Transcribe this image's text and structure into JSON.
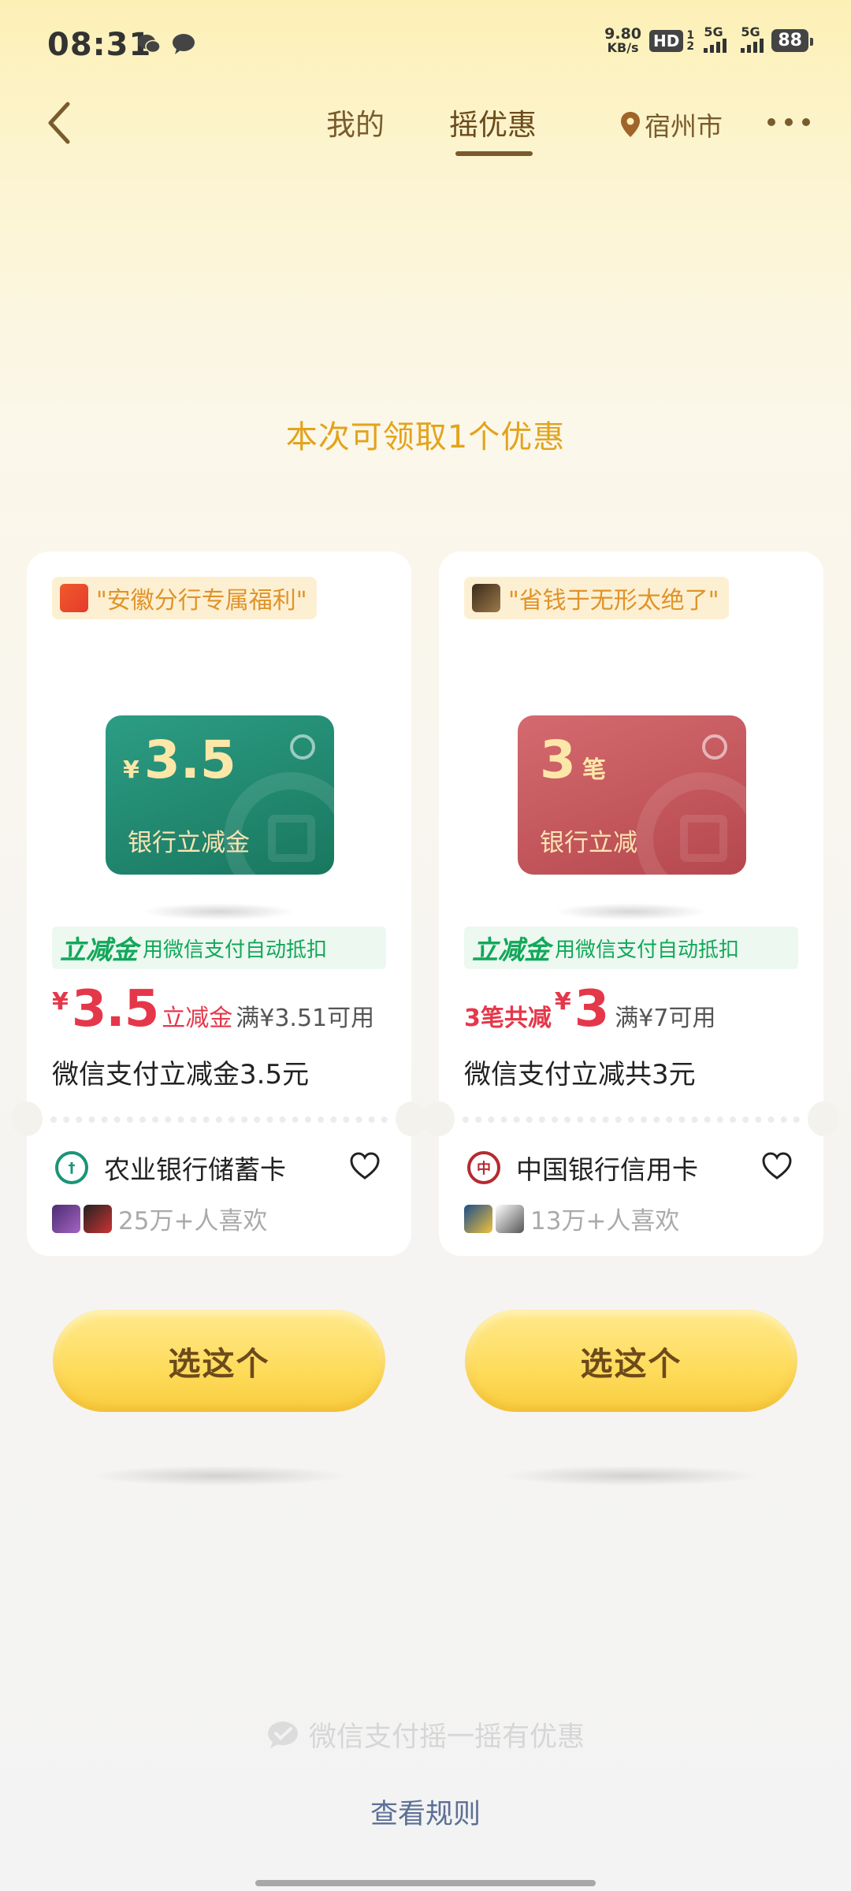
{
  "status_bar": {
    "time": "08:31",
    "net_speed_value": "9.80",
    "net_speed_unit": "KB/s",
    "hd_badge": "HD",
    "hd_sub": "1 2",
    "signal1": "5G",
    "signal2": "5G",
    "battery": "88"
  },
  "header": {
    "tabs": [
      {
        "label": "我的",
        "active": false
      },
      {
        "label": "摇优惠",
        "active": true
      }
    ],
    "location": "宿州市"
  },
  "headline": "本次可领取1个优惠",
  "cards": [
    {
      "tag": "\"安徽分行专属福利\"",
      "bank_card": {
        "currency": "¥",
        "amount": "3.5",
        "unit": "",
        "label": "银行立减金",
        "color": "#1f8a70"
      },
      "benefit_strong": "立减金",
      "benefit_desc": "用微信支付自动抵扣",
      "price_prefix": "",
      "price_currency": "¥",
      "price_value": "3.5",
      "price_type": "立减金",
      "price_condition": "满¥3.51可用",
      "description": "微信支付立减金3.5元",
      "bank_name": "农业银行储蓄卡",
      "likes": "25万+人喜欢",
      "button": "选这个"
    },
    {
      "tag": "\"省钱于无形太绝了\"",
      "bank_card": {
        "currency": "",
        "amount": "3",
        "unit": "笔",
        "label": "银行立减",
        "color": "#c55a5f"
      },
      "benefit_strong": "立减金",
      "benefit_desc": "用微信支付自动抵扣",
      "price_prefix": "3笔共减",
      "price_currency": "¥",
      "price_value": "3",
      "price_type": "",
      "price_condition": "满¥7可用",
      "description": "微信支付立减共3元",
      "bank_name": "中国银行信用卡",
      "likes": "13万+人喜欢",
      "button": "选这个"
    }
  ],
  "footer": {
    "brand": "微信支付摇一摇有优惠",
    "rules_link": "查看规则"
  },
  "icons": {
    "back": "chevron-left-icon",
    "location": "map-pin-icon",
    "more": "more-dots-icon",
    "favorite": "heart-outline-icon",
    "brand": "wechat-pay-icon"
  },
  "colors": {
    "headline": "#e3a31c",
    "price_red": "#e5374a",
    "benefit_green": "#12a85a",
    "button_yellow": "#fedb5a",
    "rules_link": "#5c6f96"
  }
}
